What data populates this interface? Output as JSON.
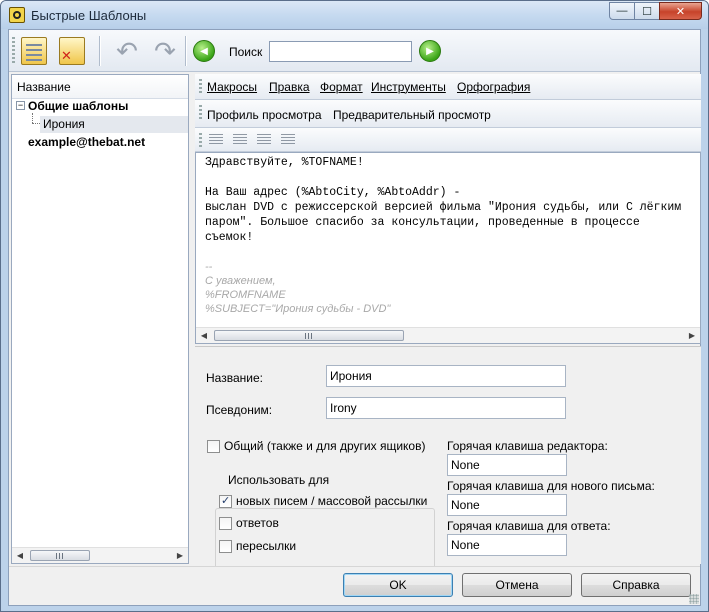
{
  "window": {
    "title": "Быстрые Шаблоны",
    "minimize": "—",
    "maximize": "☐",
    "close": "✕"
  },
  "toolbar": {
    "search_label": "Поиск",
    "search_value": "",
    "icons": [
      "new-template-icon",
      "delete-template-icon",
      "undo-icon",
      "redo-icon",
      "previous-icon",
      "next-icon"
    ]
  },
  "tree": {
    "header": "Название",
    "toggle": "−",
    "items": [
      {
        "label": "Общие шаблоны"
      },
      {
        "label": "Ирония"
      },
      {
        "label": "example@thebat.net"
      }
    ]
  },
  "menus": {
    "row1": [
      "Макросы",
      "Правка",
      "Формат",
      "Инструменты",
      "Орфография"
    ],
    "row2": [
      "Профиль просмотра",
      "Предварительный просмотр"
    ]
  },
  "editor": {
    "lines": [
      "Здравствуйте, %TOFNAME!",
      "На Ваш адрес (%AbtoCity, %AbtoAddr) -",
      "выслан DVD с режиссерской версией фильма \"Ирония судьбы, или С лёгким",
      "паром\". Большое спасибо за консультации, проведенные в процессе",
      "съемок!",
      "--",
      "С уважением,",
      "%FROMFNAME",
      "%SUBJECT=\"Ирония судьбы - DVD\""
    ]
  },
  "props": {
    "name_label": "Название:",
    "name_value": "Ирония",
    "alias_label": "Псевдоним:",
    "alias_value": "Irony",
    "shared_label": "Общий (также и для других ящиков)",
    "use_for_title": "Использовать для",
    "use_new": "новых писем / массовой рассылки",
    "use_reply": "ответов",
    "use_forward": "пересылки",
    "hotkey_editor_label": "Горячая клавиша редактора:",
    "hotkey_editor_value": "None",
    "hotkey_new_label": "Горячая клавиша для нового письма:",
    "hotkey_new_value": "None",
    "hotkey_reply_label": "Горячая клавиша для ответа:",
    "hotkey_reply_value": "None"
  },
  "buttons": {
    "ok": "OK",
    "cancel": "Отмена",
    "help": "Справка"
  }
}
